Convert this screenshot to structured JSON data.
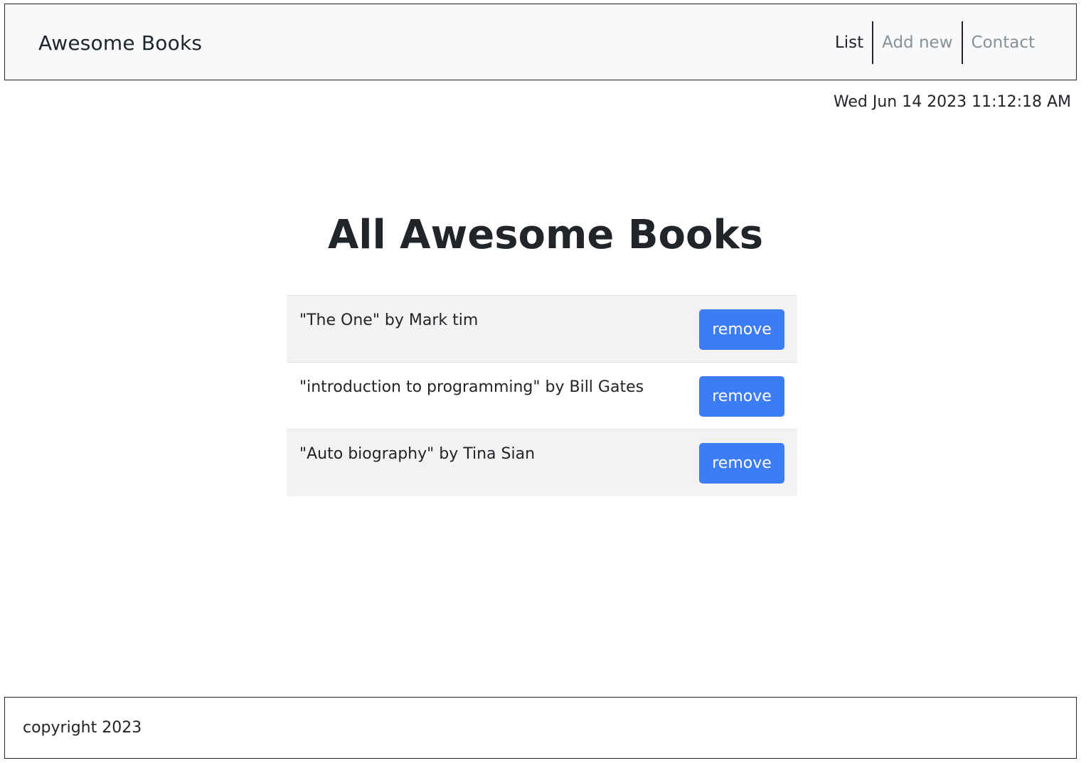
{
  "navbar": {
    "brand": "Awesome Books",
    "links": [
      {
        "label": "List",
        "active": true
      },
      {
        "label": "Add new",
        "active": false
      },
      {
        "label": "Contact",
        "active": false
      }
    ]
  },
  "datetime": "Wed Jun 14 2023 11:12:18 AM",
  "main": {
    "title": "All Awesome Books",
    "books": [
      {
        "text": "\"The One\" by Mark tim",
        "remove_label": "remove"
      },
      {
        "text": "\"introduction to programming\" by Bill Gates",
        "remove_label": "remove"
      },
      {
        "text": "\"Auto biography\" by Tina Sian",
        "remove_label": "remove"
      }
    ]
  },
  "footer": {
    "text": "copyright 2023"
  },
  "colors": {
    "accent": "#3d7cf7",
    "navbar_bg": "#f8f9fa",
    "row_shaded": "#f2f2f2",
    "muted_link": "#8a8f94"
  }
}
